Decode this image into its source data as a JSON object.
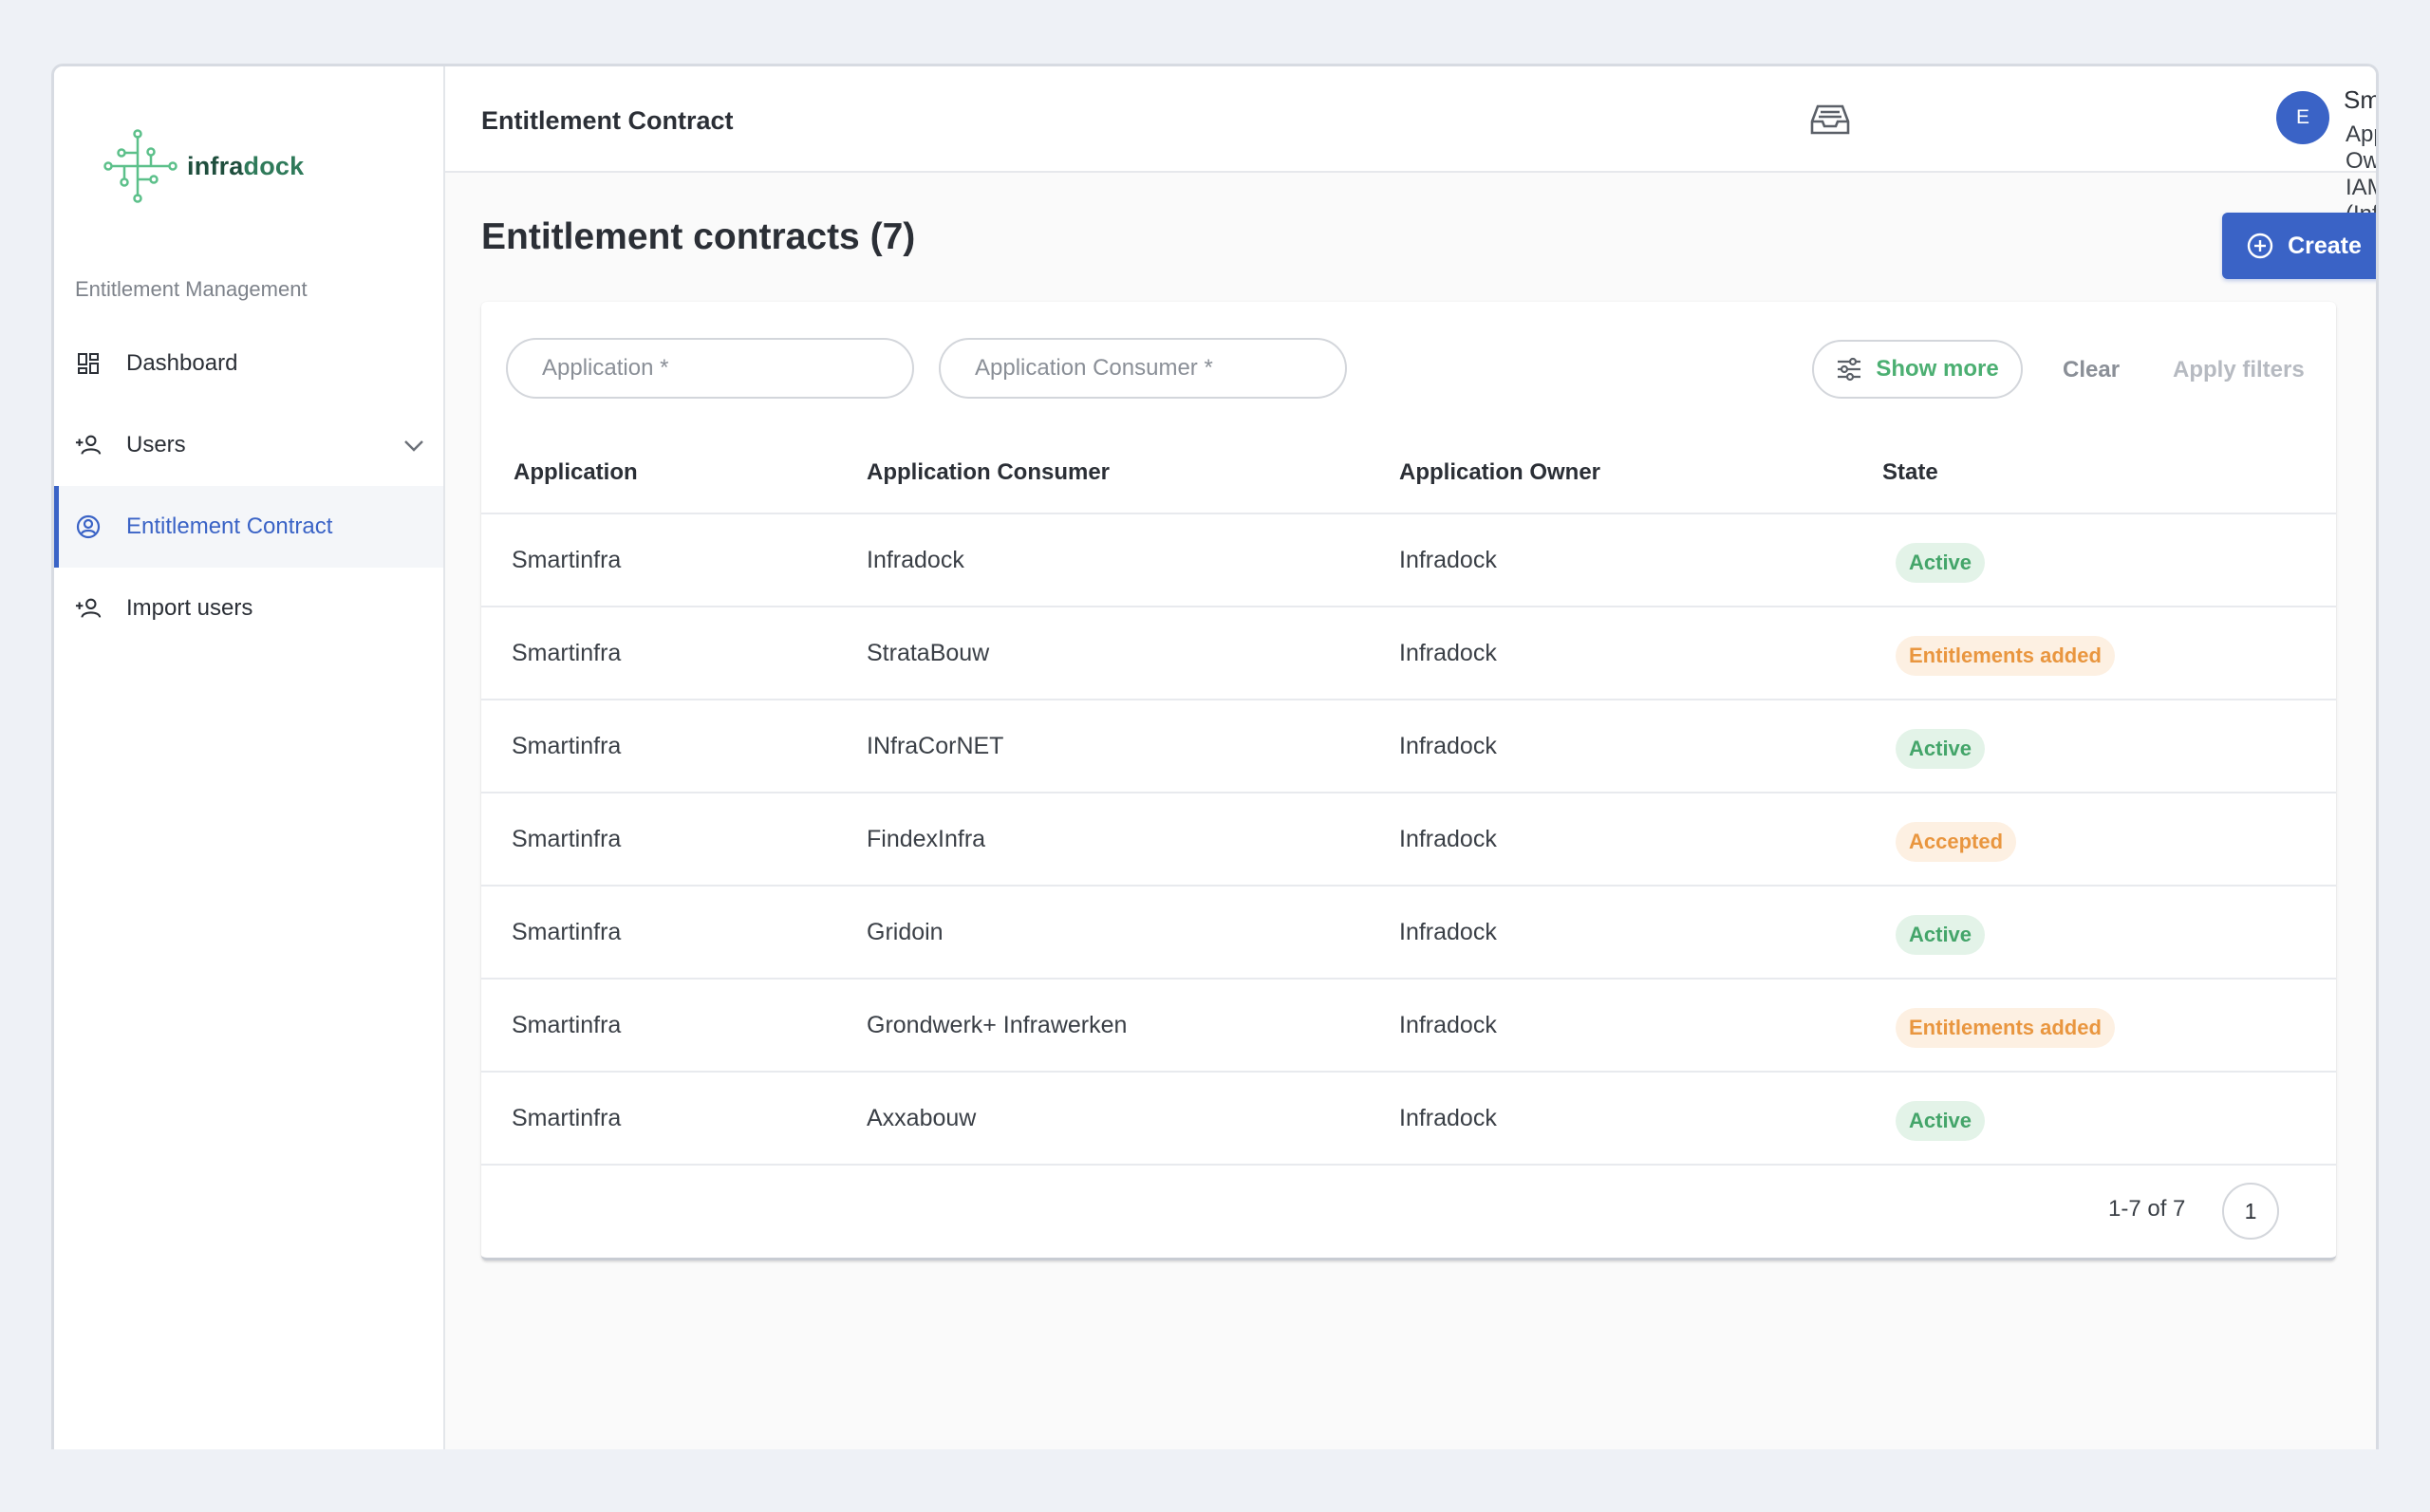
{
  "brand": {
    "logo_text_a": "infra",
    "logo_text_b": "dock",
    "subtitle": "Entitlement Management"
  },
  "sidebar": {
    "items": [
      {
        "label": "Dashboard",
        "icon": "dashboard-icon"
      },
      {
        "label": "Users",
        "icon": "add-user-icon"
      },
      {
        "label": "Entitlement Contract",
        "icon": "account-circle-icon"
      },
      {
        "label": "Import users",
        "icon": "add-user-icon"
      }
    ],
    "active_index": 2
  },
  "header": {
    "title": "Entitlement Contract",
    "user_initial": "E",
    "user_email": "Smartinfra.account@infradock.net",
    "user_role": "Application Owner in IAM (Infrado..."
  },
  "page": {
    "title": "Entitlement contracts (7)",
    "create_label": "Create"
  },
  "filters": {
    "application_placeholder": "Application *",
    "consumer_placeholder": "Application Consumer *",
    "show_more_label": "Show more",
    "clear_label": "Clear",
    "apply_label": "Apply filters"
  },
  "table": {
    "columns": [
      "Application",
      "Application Consumer",
      "Application Owner",
      "State"
    ],
    "rows": [
      {
        "application": "Smartinfra",
        "consumer": "Infradock",
        "owner": "Infradock",
        "state": "Active"
      },
      {
        "application": "Smartinfra",
        "consumer": "StrataBouw",
        "owner": "Infradock",
        "state": "Entitlements added"
      },
      {
        "application": "Smartinfra",
        "consumer": "INfraCorNET",
        "owner": "Infradock",
        "state": "Active"
      },
      {
        "application": "Smartinfra",
        "consumer": "FindexInfra",
        "owner": "Infradock",
        "state": "Accepted"
      },
      {
        "application": "Smartinfra",
        "consumer": "Gridoin",
        "owner": "Infradock",
        "state": "Active"
      },
      {
        "application": "Smartinfra",
        "consumer": "Grondwerk+ Infrawerken",
        "owner": "Infradock",
        "state": "Entitlements added"
      },
      {
        "application": "Smartinfra",
        "consumer": "Axxabouw",
        "owner": "Infradock",
        "state": "Active"
      }
    ]
  },
  "pagination": {
    "range_text": "1-7 of 7",
    "current_page": "1"
  },
  "colors": {
    "accent": "#3a63c6",
    "status_active_bg": "#e3f3e8",
    "status_active_fg": "#44a56a",
    "status_orange_bg": "#fdf0e2",
    "status_orange_fg": "#e9963f"
  }
}
